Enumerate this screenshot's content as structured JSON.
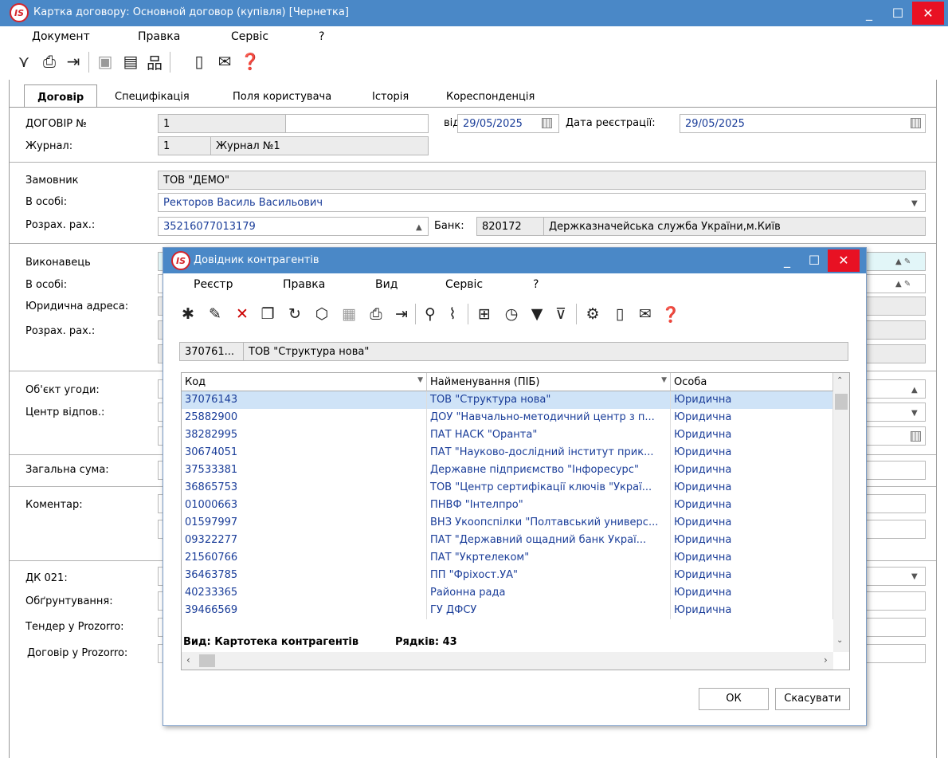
{
  "window": {
    "title": "Картка договору:  Основной договор (купівля) [Чернетка]",
    "logo": "IS"
  },
  "menu": [
    "Документ",
    "Правка",
    "Сервіс",
    "?"
  ],
  "toolbar_icons": [
    "filter-icon",
    "print-icon",
    "exit-icon",
    "save-icon",
    "hierarchy-icon",
    "document-icon",
    "mail-icon",
    "help-icon"
  ],
  "tabs": [
    "Договір",
    "Специфікація",
    "Поля користувача",
    "Історія",
    "Кореспонденція"
  ],
  "form": {
    "contract_label": "ДОГОВІР №",
    "contract_no": "1",
    "date_from_label": "від",
    "date_from": "29/05/2025",
    "reg_date_label": "Дата реєстрації:",
    "reg_date": "29/05/2025",
    "journal_label": "Журнал:",
    "journal_no": "1",
    "journal_name": "Журнал №1",
    "customer_label": "Замовник",
    "customer": "ТОВ \"ДЕМО\"",
    "person_label": "В особі:",
    "person": "Ректоров Василь Васильович",
    "account_label": "Розрах. рах.:",
    "account": "35216077013179",
    "bank_label": "Банк:",
    "bank_code": "820172",
    "bank_name": "Держказначейська служба України,м.Київ",
    "executor_label": "Виконавець",
    "exec_person_label": "В особі:",
    "legal_address_label": "Юридична адреса:",
    "exec_account_label": "Розрах. рах.:",
    "object_label": "Об'єкт угоди:",
    "resp_center_label": "Центр відпов.:",
    "total_label": "Загальна сума:",
    "comment_label": "Коментар:",
    "dk_label": "ДК 021:",
    "justification_label": "Обґрунтування:",
    "tender_label": "Тендер у Prozorro:",
    "prozorro_contract_label": "Договір у Prozorro:"
  },
  "dialog": {
    "title": "Довідник контрагентів",
    "menu": [
      "Реєстр",
      "Правка",
      "Вид",
      "Сервіс",
      "?"
    ],
    "selected_code": "370761...",
    "selected_name": "ТОВ \"Структура нова\"",
    "columns": [
      "Код",
      "Найменування (ПІБ)",
      "Особа"
    ],
    "rows": [
      {
        "code": "37076143",
        "name": "ТОВ \"Структура нова\"",
        "type": "Юридична"
      },
      {
        "code": "25882900",
        "name": "ДОУ \"Навчально-методичний центр з п...",
        "type": "Юридична"
      },
      {
        "code": "38282995",
        "name": "ПАТ  НАСК \"Оранта\"",
        "type": "Юридична"
      },
      {
        "code": "30674051",
        "name": "ПАТ \"Науково-дослідний інститут прик...",
        "type": "Юридична"
      },
      {
        "code": "37533381",
        "name": "Державне підприємство \"Інфоресурс\"",
        "type": "Юридична"
      },
      {
        "code": "36865753",
        "name": "ТОВ \"Центр сертифікації ключів \"Украї...",
        "type": "Юридична"
      },
      {
        "code": "01000663",
        "name": "ПНВФ \"Інтелпро\"",
        "type": "Юридична"
      },
      {
        "code": "01597997",
        "name": "ВНЗ Укоопспілки \"Полтавський универс...",
        "type": "Юридична"
      },
      {
        "code": "09322277",
        "name": "ПАТ  \"Державний ощадний банк Украї...",
        "type": "Юридична"
      },
      {
        "code": "21560766",
        "name": "ПАТ \"Укртелеком\"",
        "type": "Юридична"
      },
      {
        "code": "36463785",
        "name": "ПП \"Фріхост.УА\"",
        "type": "Юридична"
      },
      {
        "code": "40233365",
        "name": "Районна рада",
        "type": "Юридична"
      },
      {
        "code": "39466569",
        "name": "ГУ ДФСУ",
        "type": "Юридична"
      }
    ],
    "view_label": "Вид: Картотека контрагентів",
    "rows_label": "Рядків: 43",
    "ok_label": "ОК",
    "cancel_label": "Скасувати"
  }
}
